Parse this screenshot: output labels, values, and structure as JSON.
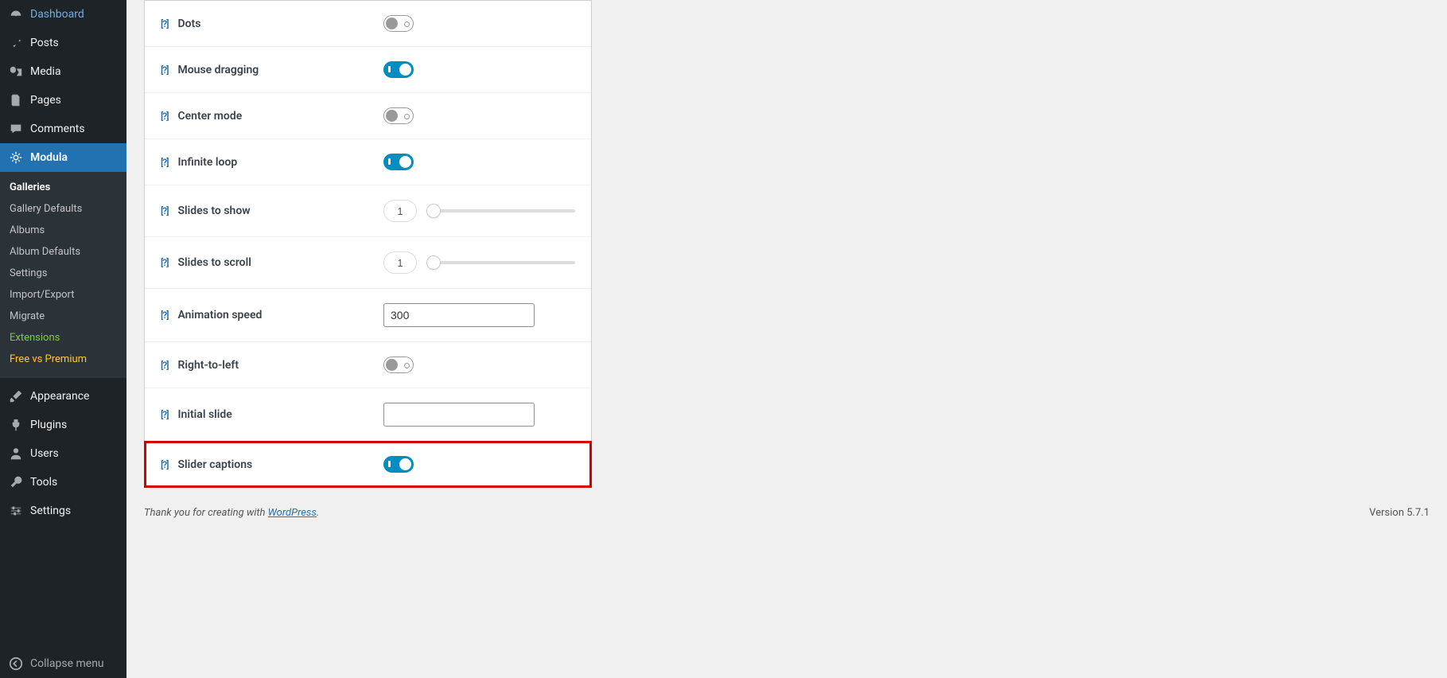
{
  "sidebar": {
    "main_items": [
      {
        "id": "dashboard",
        "label": "Dashboard",
        "icon": "dashboard"
      },
      {
        "id": "posts",
        "label": "Posts",
        "icon": "pin"
      },
      {
        "id": "media",
        "label": "Media",
        "icon": "media"
      },
      {
        "id": "pages",
        "label": "Pages",
        "icon": "page"
      },
      {
        "id": "comments",
        "label": "Comments",
        "icon": "comment"
      },
      {
        "id": "modula",
        "label": "Modula",
        "icon": "modula",
        "current": true
      }
    ],
    "submenu": [
      {
        "label": "Galleries",
        "active": true
      },
      {
        "label": "Gallery Defaults"
      },
      {
        "label": "Albums"
      },
      {
        "label": "Album Defaults"
      },
      {
        "label": "Settings"
      },
      {
        "label": "Import/Export"
      },
      {
        "label": "Migrate"
      },
      {
        "label": "Extensions",
        "variant": "ext"
      },
      {
        "label": "Free vs Premium",
        "variant": "fvp"
      }
    ],
    "lower_items": [
      {
        "id": "appearance",
        "label": "Appearance",
        "icon": "brush"
      },
      {
        "id": "plugins",
        "label": "Plugins",
        "icon": "plug"
      },
      {
        "id": "users",
        "label": "Users",
        "icon": "user"
      },
      {
        "id": "tools",
        "label": "Tools",
        "icon": "wrench"
      },
      {
        "id": "settings",
        "label": "Settings",
        "icon": "sliders"
      }
    ],
    "collapse_label": "Collapse menu"
  },
  "settings_rows": [
    {
      "key": "dots",
      "label": "Dots",
      "type": "toggle",
      "value": false
    },
    {
      "key": "mouse_dragging",
      "label": "Mouse dragging",
      "type": "toggle",
      "value": true
    },
    {
      "key": "center_mode",
      "label": "Center mode",
      "type": "toggle",
      "value": false
    },
    {
      "key": "infinite_loop",
      "label": "Infinite loop",
      "type": "toggle",
      "value": true
    },
    {
      "key": "slides_to_show",
      "label": "Slides to show",
      "type": "slider",
      "value": 1
    },
    {
      "key": "slides_to_scroll",
      "label": "Slides to scroll",
      "type": "slider",
      "value": 1
    },
    {
      "key": "animation_speed",
      "label": "Animation speed",
      "type": "text",
      "value": "300"
    },
    {
      "key": "right_to_left",
      "label": "Right-to-left",
      "type": "toggle",
      "value": false
    },
    {
      "key": "initial_slide",
      "label": "Initial slide",
      "type": "text",
      "value": ""
    },
    {
      "key": "slider_captions",
      "label": "Slider captions",
      "type": "toggle",
      "value": true,
      "highlight": true
    }
  ],
  "help_glyph": "[?]",
  "footer": {
    "thanks_prefix": "Thank you for creating with ",
    "link_text": "WordPress",
    "thanks_suffix": ".",
    "version": "Version 5.7.1"
  }
}
